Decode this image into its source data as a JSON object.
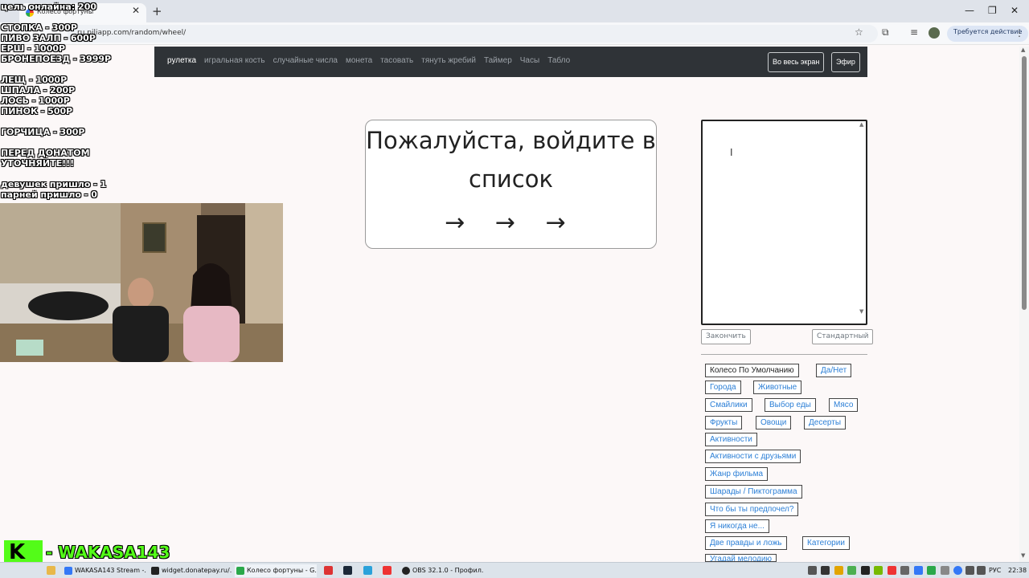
{
  "browser": {
    "tab_title": "Колесо фортуны",
    "url": "ru.piliapp.com/random/wheel/",
    "action_required": "Требуется действие"
  },
  "navbar": {
    "links": [
      "рулетка",
      "игральная кость",
      "случайные числа",
      "монета",
      "тасовать",
      "тянуть жребий",
      "Таймер",
      "Часы",
      "Табло"
    ],
    "fullscreen": "Во весь экран",
    "broadcast": "Эфир"
  },
  "card": {
    "line1": "Пожалуйста, войдите в",
    "line2": "список",
    "arrows": "→ → →"
  },
  "editor": {
    "value": "",
    "finish": "Закончить",
    "standard": "Стандартный"
  },
  "presets": [
    "Колесо По Умолчанию",
    "Да/Нет",
    "Города",
    "Животные",
    "Смайлики",
    "Выбор еды",
    "Мясо",
    "Фрукты",
    "Овощи",
    "Десерты",
    "Активности",
    "Активности с друзьями",
    "Жанр фильма",
    "Шарады / Пиктограмма",
    "Что бы ты предпочел?",
    "Я никогда не...",
    "Две правды и ложь",
    "Категории",
    "Угадай мелодию"
  ],
  "overlay": {
    "lines": [
      "цель онлайна: 200",
      "",
      "СТОПКА - 300Р",
      "ПИВО ЗАЛП - 600Р",
      "ЕРШ - 1000Р",
      "БРОНЕПОЕЗД - 3999Р",
      "",
      "ЛЕЩ - 1000Р",
      "ШПАЛА - 200Р",
      "ЛОСЬ - 1000Р",
      "ПИНОК - 500Р",
      "",
      "ГОРЧИЦА - 300Р",
      "",
      "ПЕРЕД  ДОНАТОМ",
      "УТОЧНЯЙТЕ!!!",
      "",
      "девушек пришло - 1",
      "парней пришло - 0"
    ]
  },
  "channel": {
    "logo": "K",
    "name": "- WAKASA143"
  },
  "taskbar": {
    "items": [
      "WAKASA143 Stream -...",
      "widget.donatepay.ru/...",
      "Колесо фортуны - G...",
      "OBS 32.1.0 - Профил..."
    ],
    "language": "РУС",
    "time": "22:38"
  },
  "colors": {
    "navbar": "#2f3337",
    "link_blue": "#2c7fd6",
    "kick_green": "#53fc18"
  }
}
